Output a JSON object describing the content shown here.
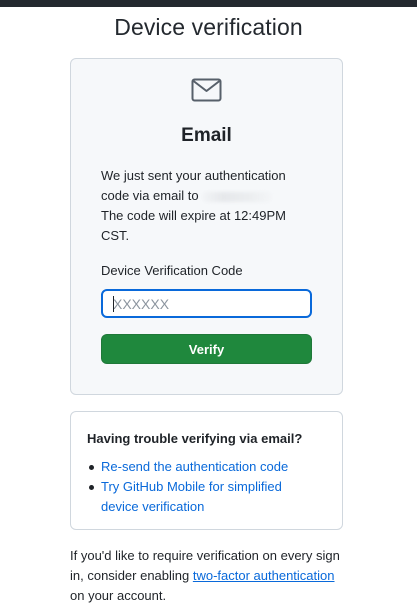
{
  "page": {
    "title": "Device verification"
  },
  "card": {
    "icon": "mail-icon",
    "heading": "Email",
    "message_line1": "We just sent your authentication",
    "message_line2": "code via email to",
    "message_line3": "The code will expire at 12:49PM",
    "message_line4": "CST.",
    "field_label": "Device Verification Code",
    "input_value": "",
    "input_placeholder": "XXXXXX",
    "verify_label": "Verify"
  },
  "help": {
    "heading": "Having trouble verifying via email?",
    "links": [
      {
        "label": "Re-send the authentication code"
      },
      {
        "label": "Try GitHub Mobile for simplified device verification"
      }
    ]
  },
  "footer": {
    "text_before_link": "If you'd like to require verification on every sign in, consider enabling ",
    "link_label": "two-factor authentication",
    "text_after_link": " on your account."
  },
  "colors": {
    "primary_button": "#1f883d",
    "link": "#0969da",
    "focus_border": "#0969da",
    "card_background": "#f6f8fa",
    "border": "#d0d7de"
  }
}
